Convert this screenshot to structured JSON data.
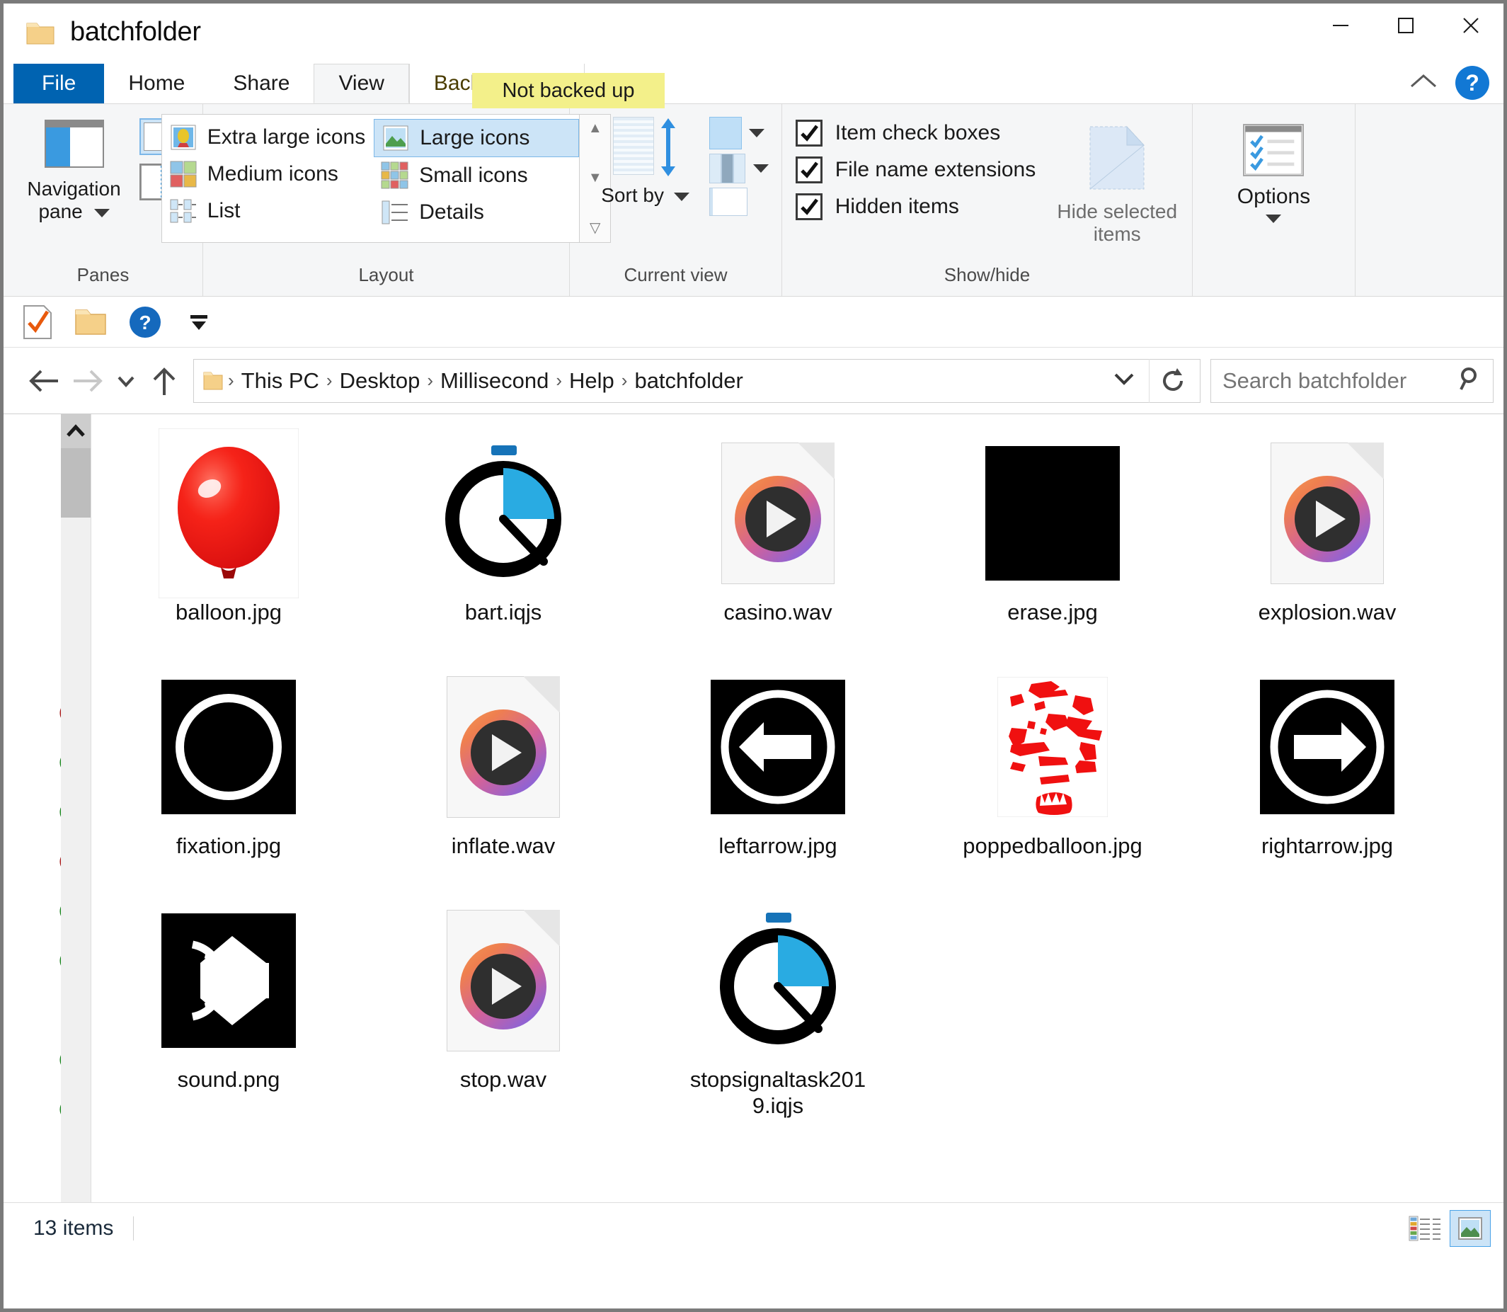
{
  "window": {
    "title": "batchfolder",
    "folder_icon": "folder-icon",
    "minimize": "minimize-icon",
    "maximize": "maximize-icon",
    "close": "close-icon"
  },
  "tabs": {
    "file": "File",
    "home": "Home",
    "share": "Share",
    "view": "View",
    "backup_tools": "Backup Tools",
    "context_banner": "Not backed up",
    "help": "?"
  },
  "ribbon": {
    "panes": {
      "group_label": "Panes",
      "navigation_pane": "Navigation\npane",
      "navigation_pane_line1": "Navigation",
      "navigation_pane_line2": "pane"
    },
    "layout": {
      "group_label": "Layout",
      "items": [
        {
          "label": "Extra large icons",
          "selected": false
        },
        {
          "label": "Large icons",
          "selected": true
        },
        {
          "label": "Medium icons",
          "selected": false
        },
        {
          "label": "Small icons",
          "selected": false
        },
        {
          "label": "List",
          "selected": false
        },
        {
          "label": "Details",
          "selected": false
        }
      ]
    },
    "current_view": {
      "group_label": "Current view",
      "sort_by_line1": "Sort",
      "sort_by_line2": "by"
    },
    "show_hide": {
      "group_label": "Show/hide",
      "checkboxes": [
        {
          "label": "Item check boxes",
          "checked": true
        },
        {
          "label": "File name extensions",
          "checked": true
        },
        {
          "label": "Hidden items",
          "checked": true
        }
      ],
      "hide_selected_line1": "Hide selected",
      "hide_selected_line2": "items"
    },
    "options": {
      "label": "Options"
    }
  },
  "quick_access": {
    "items": [
      {
        "name": "properties-icon"
      },
      {
        "name": "new-folder-icon"
      },
      {
        "name": "help-icon"
      },
      {
        "name": "customize-dropdown-icon"
      }
    ]
  },
  "address_bar": {
    "back": "back-arrow-icon",
    "forward": "forward-arrow-icon",
    "recent": "recent-locations-icon",
    "up": "up-arrow-icon",
    "breadcrumbs": [
      "This PC",
      "Desktop",
      "Millisecond",
      "Help",
      "batchfolder"
    ],
    "separator": "›",
    "dropdown": "chevron-down-icon",
    "refresh": "refresh-icon",
    "search_placeholder": "Search batchfolder",
    "search_value": "",
    "search_icon": "search-icon"
  },
  "files": [
    {
      "name": "balloon.jpg",
      "icon": "balloon-image"
    },
    {
      "name": "bart.iqjs",
      "icon": "stopwatch-icon"
    },
    {
      "name": "casino.wav",
      "icon": "media-file-icon"
    },
    {
      "name": "erase.jpg",
      "icon": "black-square-image"
    },
    {
      "name": "explosion.wav",
      "icon": "media-file-icon"
    },
    {
      "name": "fixation.jpg",
      "icon": "black-circle-image"
    },
    {
      "name": "inflate.wav",
      "icon": "media-file-icon"
    },
    {
      "name": "leftarrow.jpg",
      "icon": "left-arrow-image"
    },
    {
      "name": "poppedballoon.jpg",
      "icon": "popped-balloon-image"
    },
    {
      "name": "rightarrow.jpg",
      "icon": "right-arrow-image"
    },
    {
      "name": "sound.png",
      "icon": "speaker-image"
    },
    {
      "name": "stop.wav",
      "icon": "media-file-icon"
    },
    {
      "name": "stopsignaltask2019.iqjs",
      "icon": "stopwatch-icon"
    }
  ],
  "nav_pane": {
    "scroll_up": "scroll-up-icon",
    "scroll_down": "scroll-down-icon",
    "quick_access_star": "star-icon"
  },
  "status_bar": {
    "item_count": "13 items",
    "details_view": "details-view-icon",
    "large_icons_view": "large-icons-view-icon"
  },
  "colors": {
    "file_tab_blue": "#0063b1",
    "selection_blue": "#cce4f7",
    "banner_yellow": "#f3f08a",
    "help_blue": "#1278d4",
    "folder_yellow": "#f7d388"
  }
}
